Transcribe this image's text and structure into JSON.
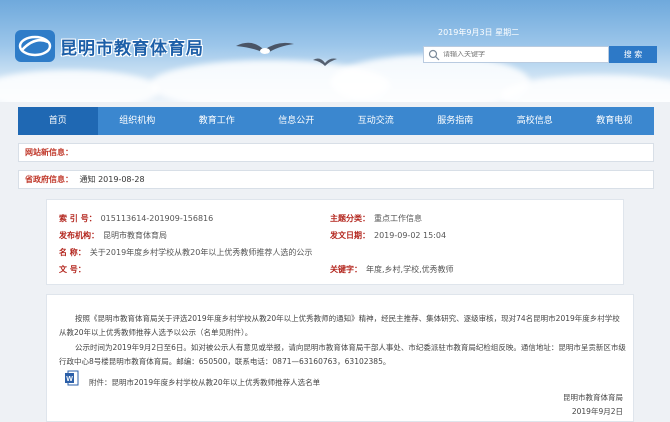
{
  "header": {
    "site_name": "昆明市教育体育局",
    "date": "2019年9月3日 星期二",
    "search_placeholder": "请输入关键字",
    "search_button": "搜 索"
  },
  "nav": {
    "items": [
      "首页",
      "组织机构",
      "教育工作",
      "信息公开",
      "互动交流",
      "服务指南",
      "高校信息",
      "教育电视"
    ]
  },
  "info_bars": {
    "row1": {
      "label": "网站新信息：",
      "value": ""
    },
    "row2": {
      "label": "省政府信息：",
      "value": "通知   2019-08-28"
    }
  },
  "meta": {
    "index_no_label": "索 引 号：",
    "index_no": "015113614-201909-156816",
    "topic_label": "主题分类：",
    "topic": "重点工作信息",
    "publisher_label": "发布机构：",
    "publisher": "昆明市教育体育局",
    "pub_date_label": "发文日期：",
    "pub_date": "2019-09-02 15:04",
    "name_label": "名    称：",
    "name": "关于2019年度乡村学校从教20年以上优秀教师推荐人选的公示",
    "docno_label": "文    号：",
    "docno": "",
    "keywords_label": "关键字：",
    "keywords": "年度,乡村,学校,优秀教师"
  },
  "content": {
    "para1": "按照《昆明市教育体育局关于评选2019年度乡村学校从教20年以上优秀教师的通知》精神，经民主推荐、集体研究、逐级审核，现对74名昆明市2019年度乡村学校从教20年以上优秀教师推荐人选予以公示（名单见附件）。",
    "para2": "公示时间为2019年9月2日至6日。如对被公示人有意见或举报，请向昆明市教育体育局干部人事处、市纪委派驻市教育局纪检组反映。通信地址：昆明市呈贡新区市级行政中心8号楼昆明市教育体育局。邮编：650500，联系电话：0871—63160763，63102385。",
    "attachment": "附件：昆明市2019年度乡村学校从教20年以上优秀教师推荐人选名单",
    "signer": "昆明市教育体育局",
    "sign_date": "2019年9月2日"
  }
}
